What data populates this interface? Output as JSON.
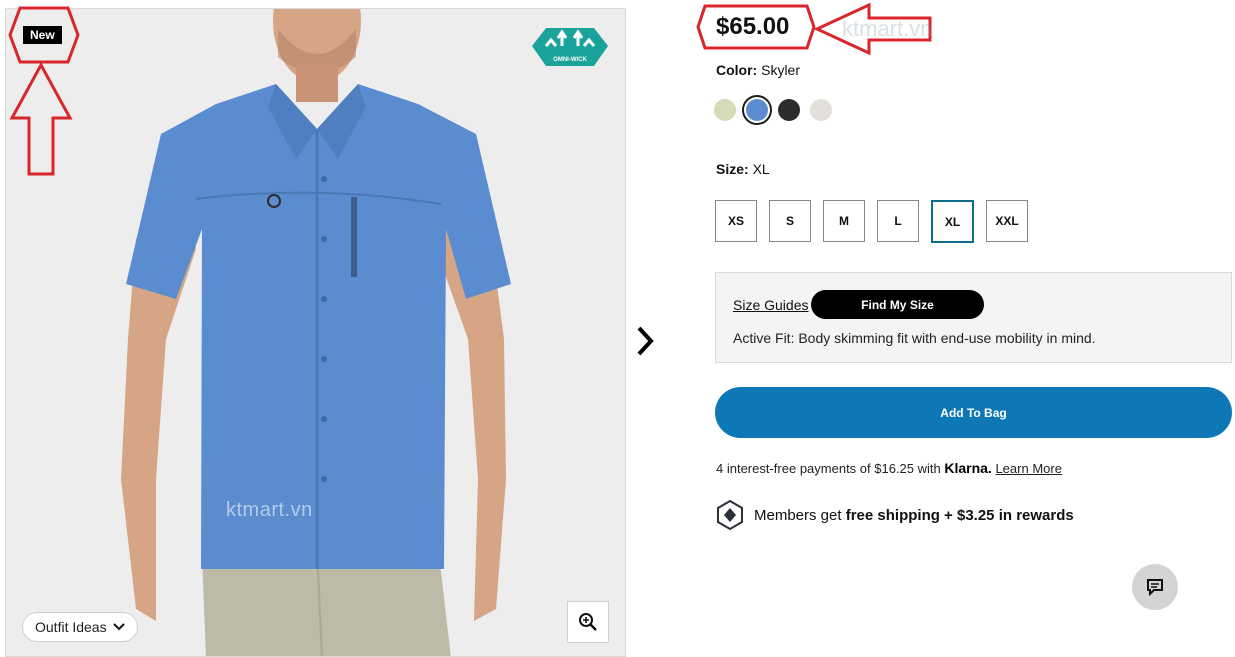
{
  "product": {
    "badge": "New",
    "price": "$65.00",
    "logo_text": "OMNI-WICK",
    "watermark": "ktmart.vn"
  },
  "color": {
    "label": "Color:",
    "value": "Skyler",
    "swatches": [
      {
        "name": "sage",
        "hex": "#d3dcb6"
      },
      {
        "name": "skyler",
        "hex": "#5a8ccf"
      },
      {
        "name": "black",
        "hex": "#2c2c2e"
      },
      {
        "name": "light-gray",
        "hex": "#e3e0dc"
      }
    ]
  },
  "size": {
    "label": "Size:",
    "value": "XL",
    "options": [
      "XS",
      "S",
      "M",
      "L",
      "XL",
      "XXL"
    ]
  },
  "fit": {
    "size_guides": "Size Guides",
    "find_my_size": "Find My Size",
    "description": "Active Fit: Body skimming fit with end-use mobility in mind."
  },
  "cart": {
    "add_to_bag": "Add To Bag"
  },
  "klarna": {
    "prefix": "4 interest-free payments of $16.25 with",
    "brand": "Klarna.",
    "learn_more": "Learn More"
  },
  "members": {
    "prefix": "Members get",
    "bold": "free shipping + $3.25 in rewards"
  },
  "gallery": {
    "outfit_ideas": "Outfit Ideas"
  },
  "colors": {
    "accent": "#0e78b6",
    "selected_size_border": "#0e6c8c",
    "annotation_red": "#d9262c"
  },
  "icons": [
    "zoom-in-icon",
    "chevron-down-icon",
    "chevron-right-icon",
    "members-diamond-icon",
    "chat-icon"
  ]
}
